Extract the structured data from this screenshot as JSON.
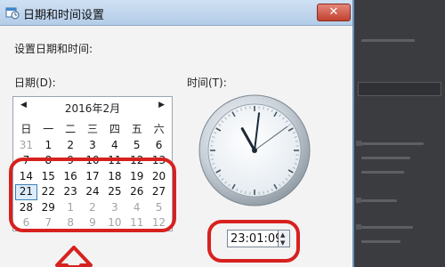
{
  "window": {
    "title": "日期和时间设置",
    "close_glyph": "✕"
  },
  "dialog": {
    "instruction": "设置日期和时间:",
    "date_label": "日期(D):",
    "time_label": "时间(T):"
  },
  "calendar": {
    "prev_glyph": "◀",
    "next_glyph": "▶",
    "month_title": "2016年2月",
    "weekdays": [
      "日",
      "一",
      "二",
      "三",
      "四",
      "五",
      "六"
    ],
    "weeks": [
      [
        "31",
        "1",
        "2",
        "3",
        "4",
        "5",
        "6"
      ],
      [
        "7",
        "8",
        "9",
        "10",
        "11",
        "12",
        "13"
      ],
      [
        "14",
        "15",
        "16",
        "17",
        "18",
        "19",
        "20"
      ],
      [
        "21",
        "22",
        "23",
        "24",
        "25",
        "26",
        "27"
      ],
      [
        "28",
        "29",
        "1",
        "2",
        "3",
        "4",
        "5"
      ],
      [
        "6",
        "7",
        "8",
        "9",
        "10",
        "11",
        "12"
      ]
    ],
    "selected_day": "21"
  },
  "time": {
    "value": "23:01:09",
    "spin_up_glyph": "▲",
    "spin_down_glyph": "▼"
  },
  "colors": {
    "annotation": "#d7211f",
    "titlebar": "#b4cde8",
    "selected_day_border": "#3c7fb1"
  },
  "icons": {
    "title_icon": "calendar-clock-icon",
    "close": "close-icon",
    "prev_month": "chevron-left-icon",
    "next_month": "chevron-right-icon",
    "annotation_arrow": "up-arrow-icon"
  }
}
